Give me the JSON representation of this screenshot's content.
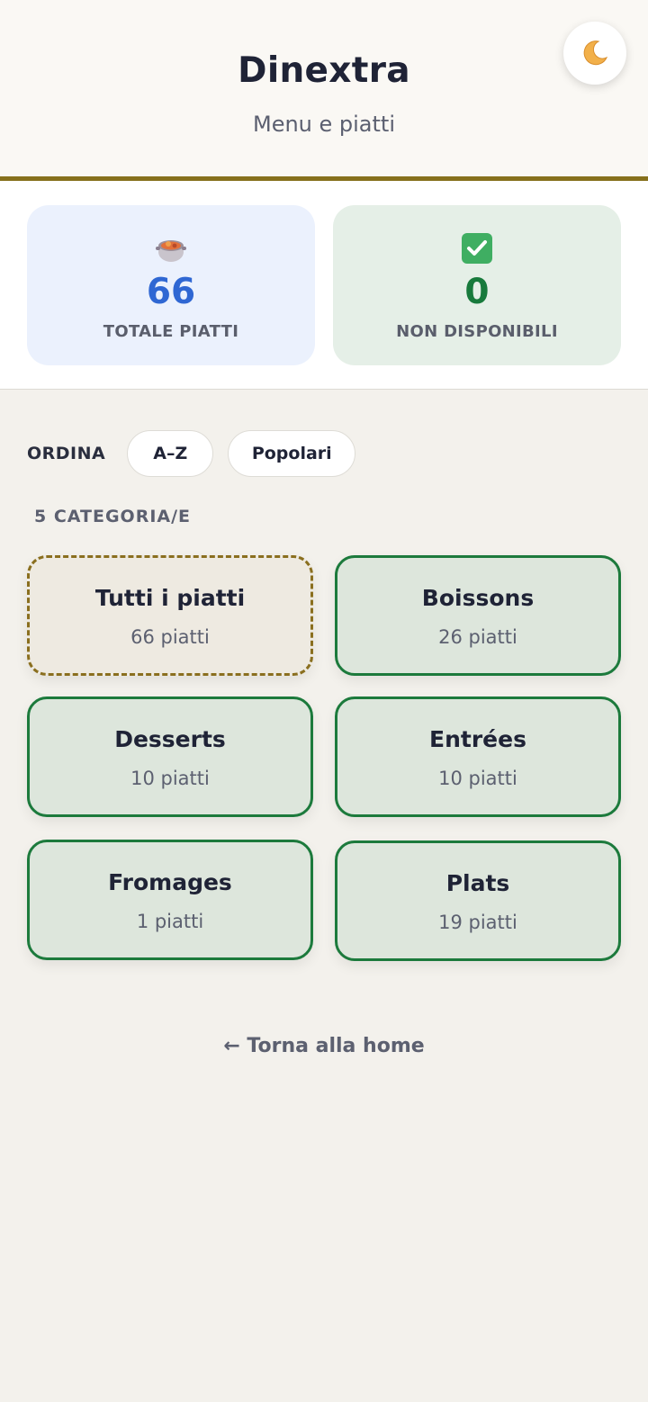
{
  "header": {
    "title": "Dinextra",
    "subtitle": "Menu e piatti",
    "theme_toggle_icon": "moon-icon"
  },
  "stats": {
    "total": {
      "icon": "cooking-pot-icon",
      "value": "66",
      "label": "TOTALE PIATTI"
    },
    "unavailable": {
      "icon": "check-mark-icon",
      "value": "0",
      "label": "NON DISPONIBILI"
    }
  },
  "sort": {
    "label": "ORDINA",
    "options": [
      "A–Z",
      "Popolari"
    ]
  },
  "categories_count_label": "5 CATEGORIA/E",
  "categories": [
    {
      "name": "Tutti i piatti",
      "count": "66 piatti"
    },
    {
      "name": "Boissons",
      "count": "26 piatti"
    },
    {
      "name": "Desserts",
      "count": "10 piatti"
    },
    {
      "name": "Entrées",
      "count": "10 piatti"
    },
    {
      "name": "Fromages",
      "count": "1 piatti"
    },
    {
      "name": "Plats",
      "count": "19 piatti"
    }
  ],
  "footer": {
    "home_link": "← Torna alla home"
  },
  "colors": {
    "accent_gold": "#86701c",
    "total_blue": "#2f67d3",
    "ok_green": "#187a3c",
    "background": "#f3f1ec"
  }
}
